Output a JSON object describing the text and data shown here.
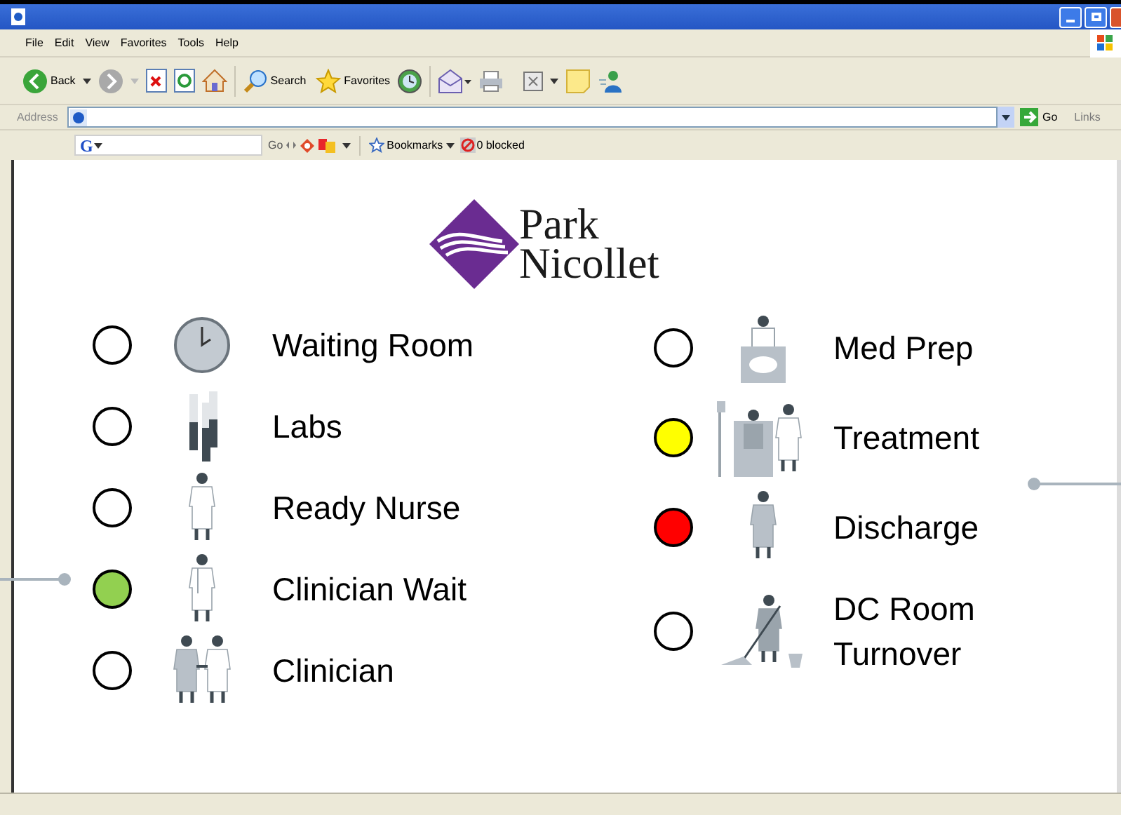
{
  "menu": [
    "File",
    "Edit",
    "View",
    "Favorites",
    "Tools",
    "Help"
  ],
  "toolbar": {
    "back": "Back",
    "search": "Search",
    "favorites": "Favorites"
  },
  "address": {
    "label": "Address",
    "go": "Go",
    "links": "Links"
  },
  "google_toolbar": {
    "logo": "G",
    "go": "Go",
    "bookmarks": "Bookmarks",
    "blocked": "0 blocked"
  },
  "logo": {
    "line1": "Park",
    "line2": "Nicollet"
  },
  "left_column": [
    {
      "label": "Waiting Room",
      "color": "#ffffff",
      "kind": "clock"
    },
    {
      "label": "Labs",
      "color": "#ffffff",
      "kind": "tubes"
    },
    {
      "label": "Ready Nurse",
      "color": "#ffffff",
      "kind": "nurse"
    },
    {
      "label": "Clinician Wait",
      "color": "#92d050",
      "kind": "doctor"
    },
    {
      "label": "Clinician",
      "color": "#ffffff",
      "kind": "handshake"
    }
  ],
  "right_column": [
    {
      "label": "Med Prep",
      "color": "#ffffff",
      "kind": "medprep"
    },
    {
      "label": "Treatment",
      "color": "#ffff00",
      "kind": "treatment"
    },
    {
      "label": "Discharge",
      "color": "#ff0000",
      "kind": "patient"
    },
    {
      "label": "DC Room Turnover",
      "color": "#ffffff",
      "kind": "mop"
    }
  ]
}
